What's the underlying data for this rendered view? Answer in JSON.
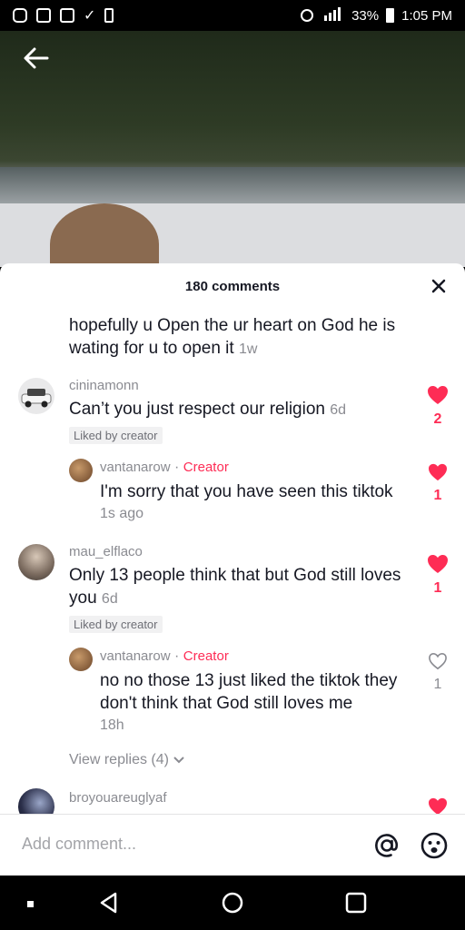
{
  "status_bar": {
    "battery": "33%",
    "time": "1:05 PM"
  },
  "sheet": {
    "title": "180 comments"
  },
  "comments": [
    {
      "text": "hopefully u Open the ur heart on God he is wating for u to open it",
      "time": "1w"
    },
    {
      "username": "cininamonn",
      "text": "Can’t you just respect our religion",
      "time": "6d",
      "liked_by": "Liked by creator",
      "likes": "2",
      "reply": {
        "username": "vantanarow",
        "sep": "·",
        "creator": "Creator",
        "text": "I'm sorry that you have seen this tiktok",
        "time": "1s ago",
        "likes": "1"
      }
    },
    {
      "username": "mau_elflaco",
      "text": "Only 13 people think that but God still loves you",
      "time": "6d",
      "liked_by": "Liked by creator",
      "likes": "1",
      "reply": {
        "username": "vantanarow",
        "sep": "·",
        "creator": "Creator",
        "text": "no no those 13 just liked the tiktok they don't think that God still loves me",
        "time": "18h",
        "likes": "1"
      },
      "view_replies": "View replies (4)"
    },
    {
      "username": "broyouareuglyaf"
    }
  ],
  "input": {
    "placeholder": "Add comment..."
  },
  "colors": {
    "accent": "#fe2c55",
    "muted": "#8a8b91"
  }
}
